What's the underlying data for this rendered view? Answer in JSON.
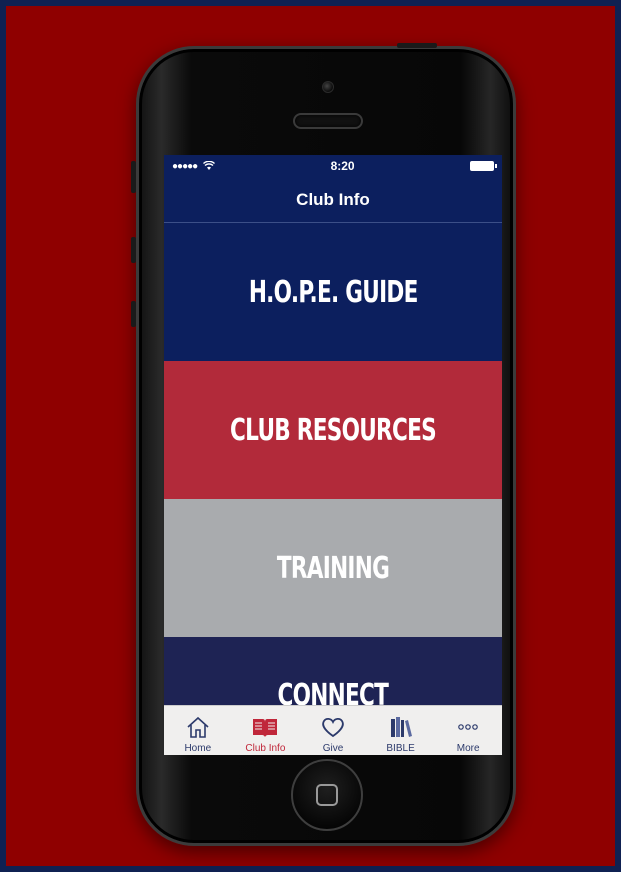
{
  "colors": {
    "background": "#8f0000",
    "frame": "#0f2152",
    "hope": "#0c1f5e",
    "resources": "#b22a3a",
    "training": "#a9abae",
    "connect": "#1e2354",
    "tab_active": "#c0273a",
    "tab_inactive": "#2c3a6b"
  },
  "status_bar": {
    "signal": "●●●●●",
    "time": "8:20"
  },
  "nav": {
    "title": "Club Info"
  },
  "menu": {
    "items": [
      {
        "label": "H.O.P.E. GUIDE"
      },
      {
        "label": "CLUB RESOURCES"
      },
      {
        "label": "TRAINING"
      },
      {
        "label": "CONNECT"
      }
    ]
  },
  "tabs": [
    {
      "label": "Home",
      "icon": "home-icon"
    },
    {
      "label": "Club Info",
      "icon": "book-icon",
      "active": true
    },
    {
      "label": "Give",
      "icon": "heart-icon"
    },
    {
      "label": "BIBLE",
      "icon": "books-icon"
    },
    {
      "label": "More",
      "icon": "more-icon"
    }
  ]
}
